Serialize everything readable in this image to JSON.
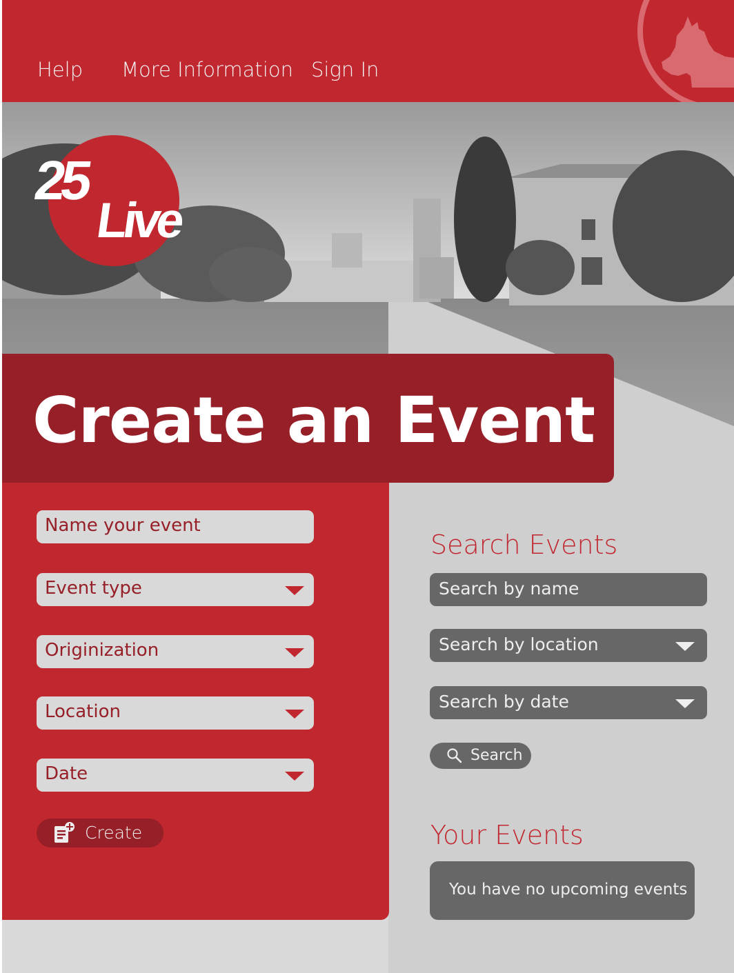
{
  "nav": {
    "help": "Help",
    "more_info": "More Information",
    "sign_in": "Sign In"
  },
  "brand": {
    "logo_top": "25",
    "logo_bottom": "Live"
  },
  "title": "Create an Event",
  "create_form": {
    "name_placeholder": "Name your event",
    "event_type": "Event type",
    "organization": "Originization",
    "location": "Location",
    "date": "Date",
    "create_label": "Create"
  },
  "search": {
    "heading": "Search Events",
    "by_name": "Search by name",
    "by_location": "Search by location",
    "by_date": "Search by date",
    "button_label": "Search"
  },
  "your_events": {
    "heading": "Your Events",
    "empty_message": "You have no upcoming events"
  },
  "icons": {
    "mascot": "scottie-dog-icon",
    "dropdown": "caret-down-icon",
    "search": "magnifier-icon",
    "create": "note-add-icon"
  },
  "colors": {
    "brand_red": "#c1272f",
    "dark_red": "#961f28",
    "field_gray": "#d9d9d9",
    "search_gray": "#676767"
  }
}
